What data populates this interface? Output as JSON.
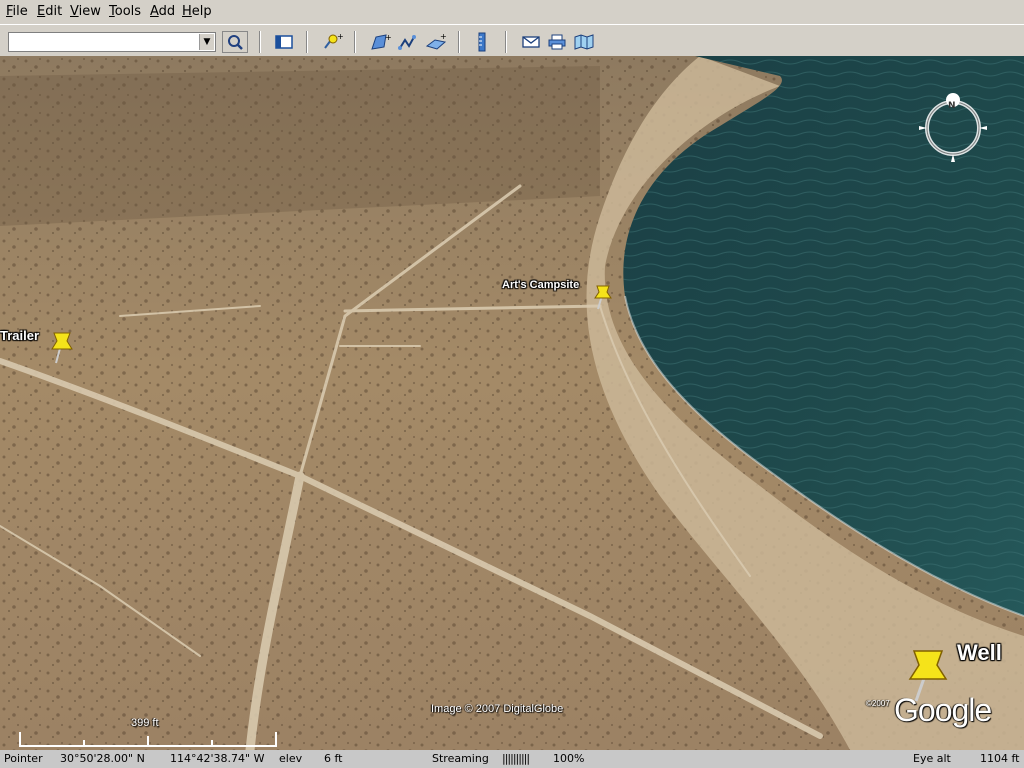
{
  "menu": {
    "items": [
      "File",
      "Edit",
      "View",
      "Tools",
      "Add",
      "Help"
    ]
  },
  "toolbar": {
    "search_value": "",
    "icons": [
      "sidebar-toggle-icon",
      "placemark-icon",
      "polygon-icon",
      "path-icon",
      "image-overlay-icon",
      "ruler-icon",
      "email-icon",
      "print-icon",
      "map-icon"
    ]
  },
  "map": {
    "placemarks": [
      {
        "label": "Trailer"
      },
      {
        "label": "Art's Campsite"
      },
      {
        "label": "Well"
      }
    ],
    "copyright": "Image © 2007 DigitalGlobe",
    "logo": "Google",
    "logo_year": "©2007",
    "scale_label": "399 ft",
    "compass_label": "N",
    "colors": {
      "water": "#1f4a4c",
      "land": "#a48a67",
      "pin": "#f5e31a"
    }
  },
  "status": {
    "pointer_label": "Pointer",
    "latitude": "30°50'28.00\" N",
    "longitude": "114°42'38.74\" W",
    "elev_label": "elev",
    "elev_value": "6 ft",
    "streaming_label": "Streaming",
    "streaming_bar": "||||||||||",
    "streaming_pct": "100%",
    "eye_alt_label": "Eye alt",
    "eye_alt_value": "1104 ft",
    "streaming_progress": 1.0
  }
}
